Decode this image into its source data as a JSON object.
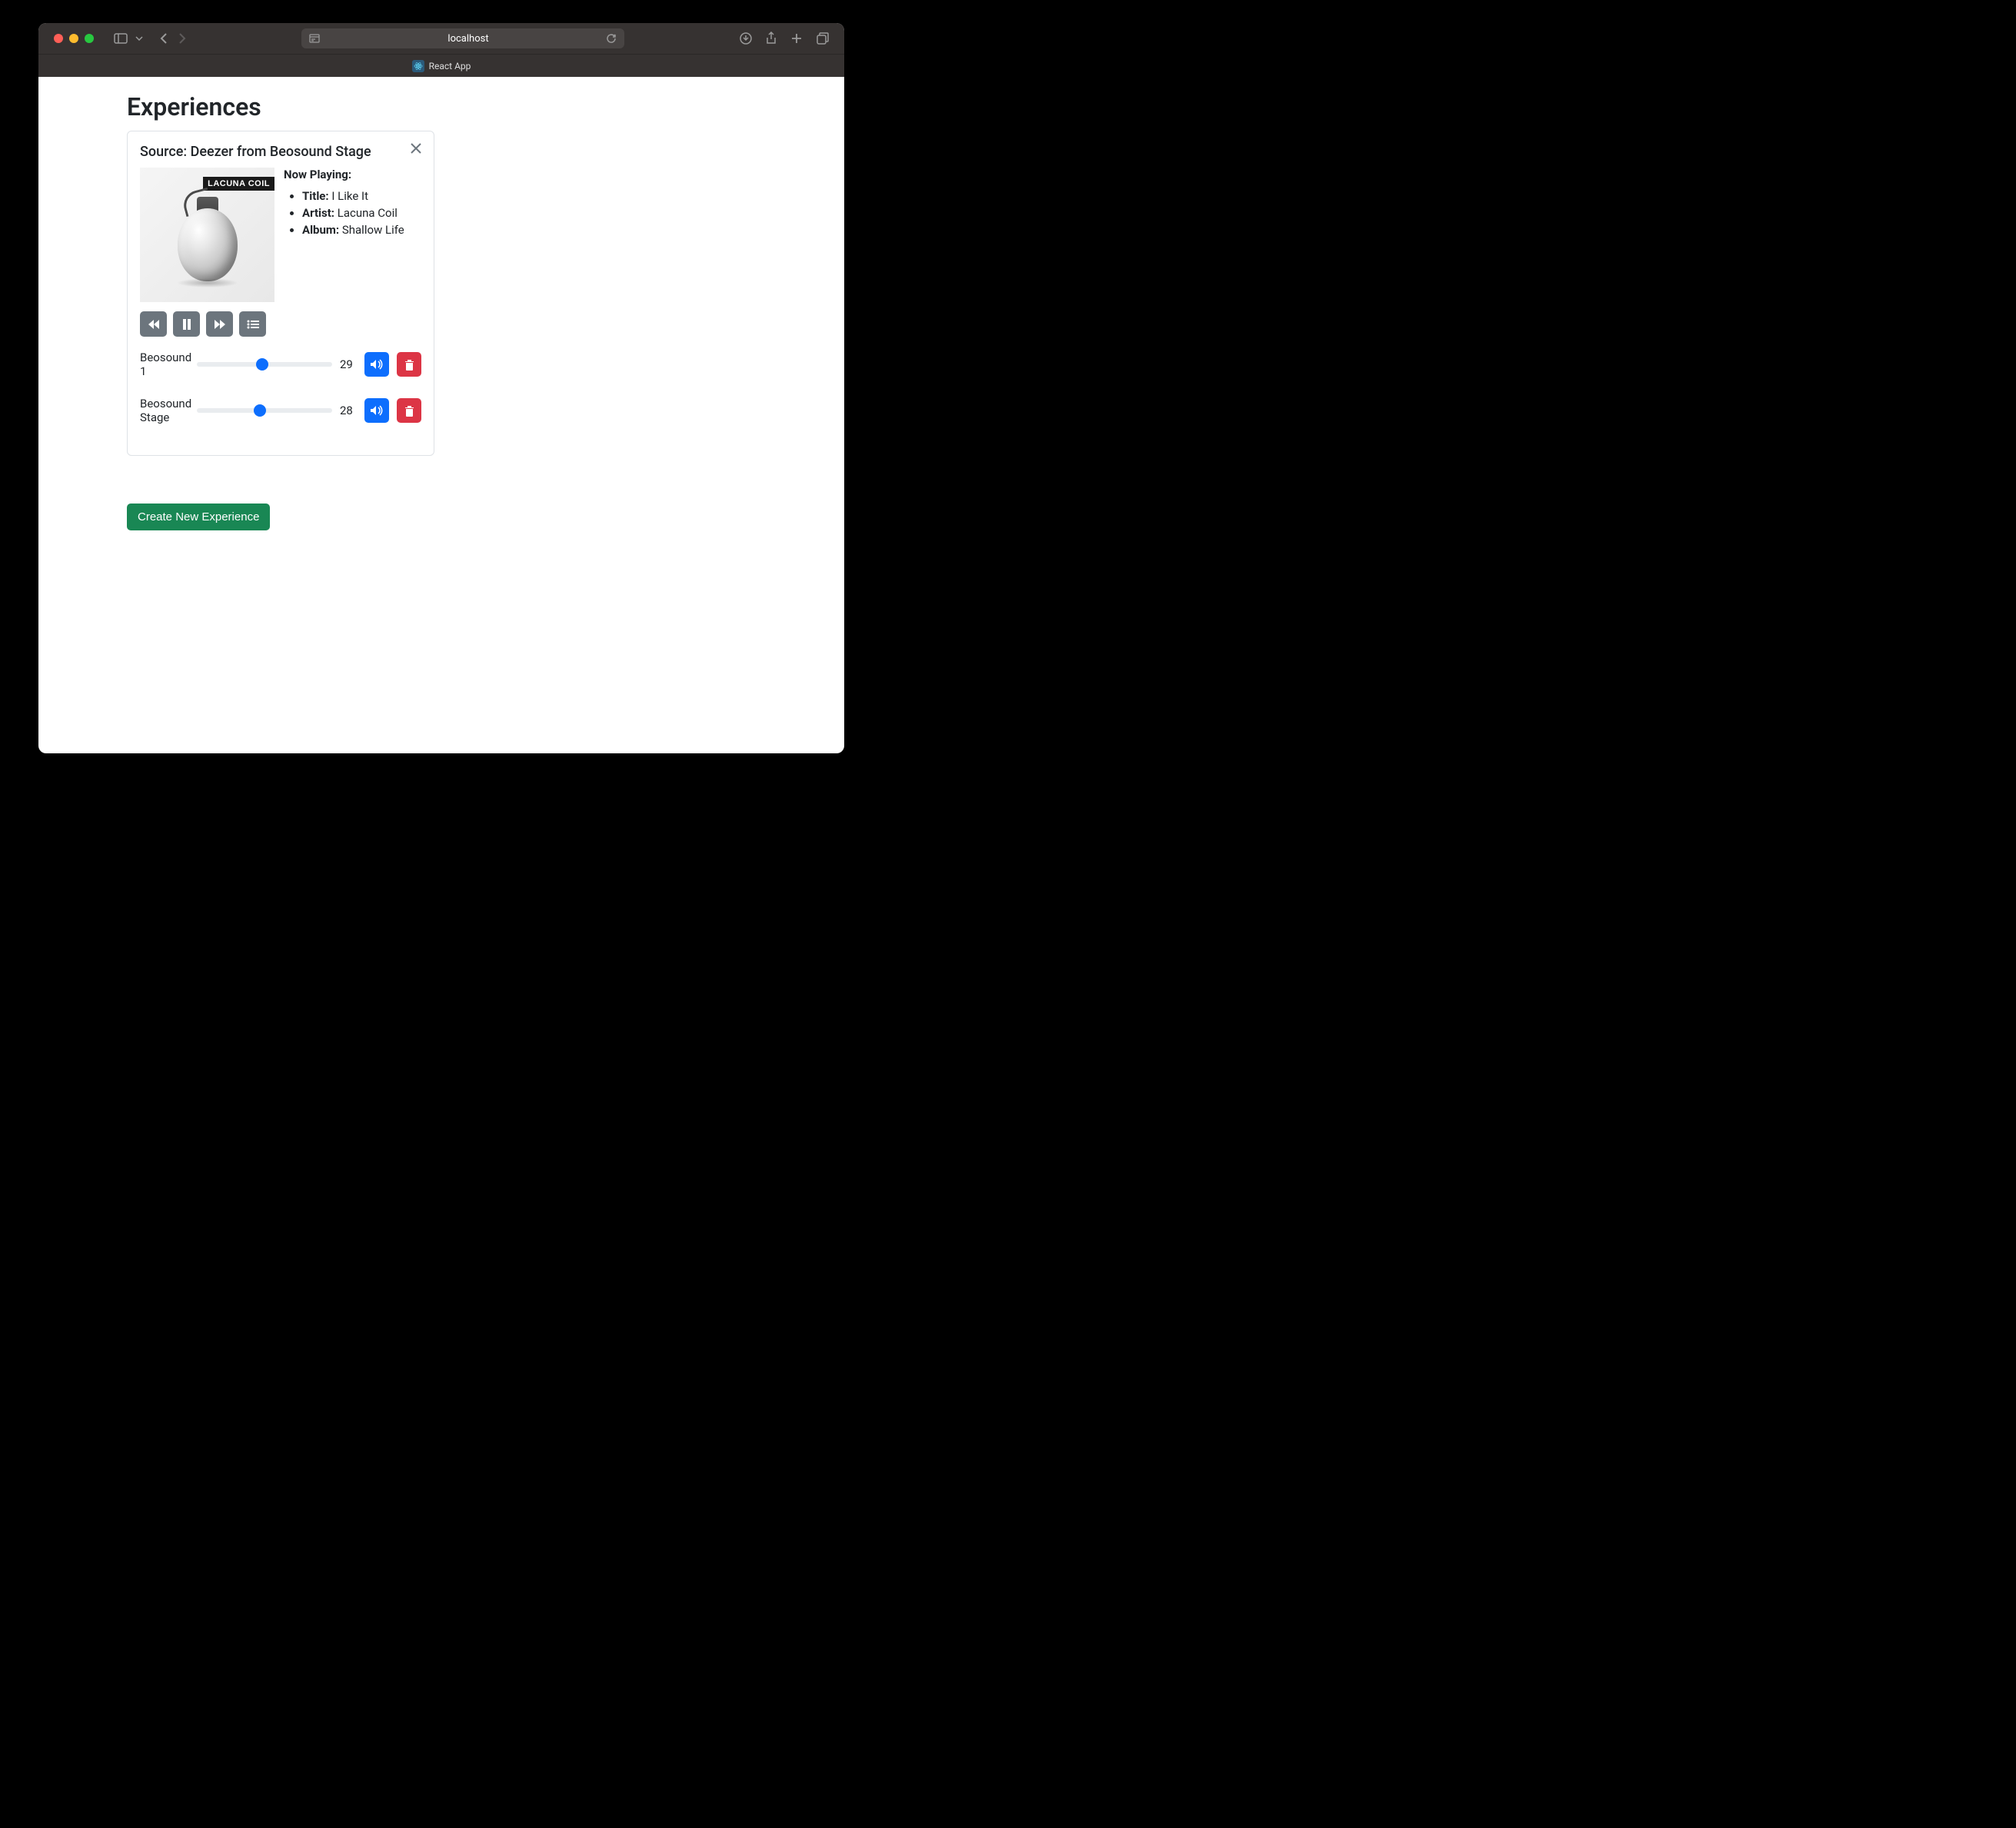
{
  "browser": {
    "address": "localhost",
    "tab_title": "React App"
  },
  "page": {
    "heading": "Experiences",
    "create_button": "Create New Experience"
  },
  "card": {
    "source_label": "Source: Deezer from Beosound Stage",
    "album_art_text": "LACUNA COIL",
    "now_playing_label": "Now Playing:",
    "track": {
      "title_label": "Title:",
      "title": "I Like It",
      "artist_label": "Artist:",
      "artist": "Lacuna Coil",
      "album_label": "Album:",
      "album": "Shallow Life"
    },
    "volumes": [
      {
        "name": "Beosound 1",
        "value": 29
      },
      {
        "name": "Beosound Stage",
        "value": 28
      }
    ]
  }
}
